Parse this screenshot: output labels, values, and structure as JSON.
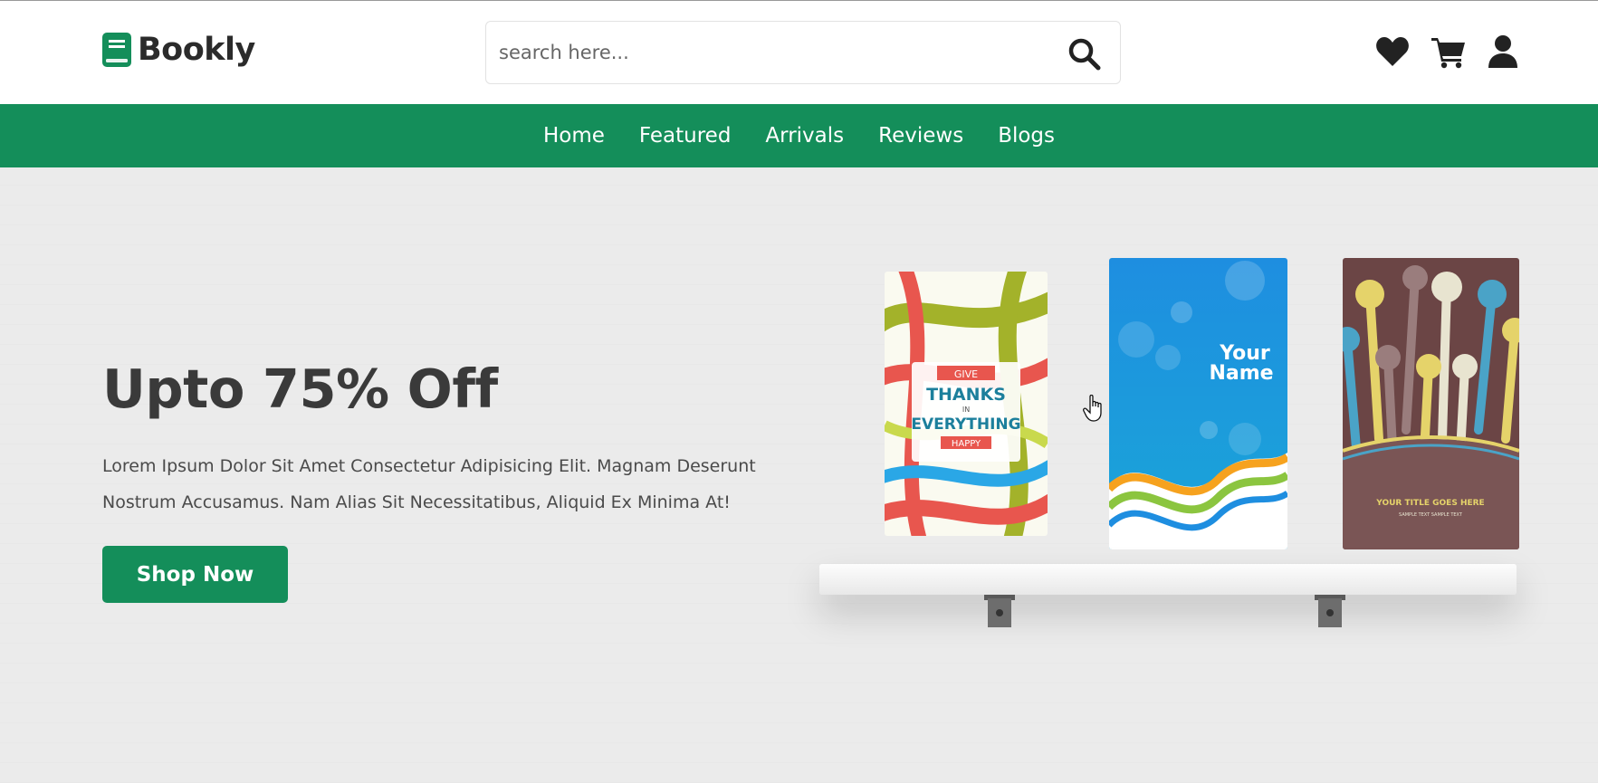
{
  "header": {
    "logo_text": "Bookly",
    "search_placeholder": "search here...",
    "icons": [
      "heart-icon",
      "cart-icon",
      "user-icon"
    ]
  },
  "nav": {
    "items": [
      "Home",
      "Featured",
      "Arrivals",
      "Reviews",
      "Blogs"
    ]
  },
  "hero": {
    "title": "Upto 75% Off",
    "text": "Lorem Ipsum Dolor Sit Amet Consectetur Adipisicing Elit. Magnam Deserunt Nostrum Accusamus. Nam Alias Sit Necessitatibus, Aliquid Ex Minima At!",
    "button_label": "Shop Now"
  },
  "books": [
    {
      "cover_lines": [
        "GIVE",
        "THANKS",
        "IN",
        "EVERYTHING",
        "HAPPY"
      ]
    },
    {
      "cover_lines": [
        "Your",
        "Name"
      ]
    },
    {
      "cover_lines": [
        "YOUR TITLE GOES HERE",
        "SAMPLE TEXT SAMPLE TEXT"
      ]
    }
  ],
  "colors": {
    "brand": "#148e5a",
    "text_dark": "#2b2b2b",
    "background": "#ebebeb"
  }
}
